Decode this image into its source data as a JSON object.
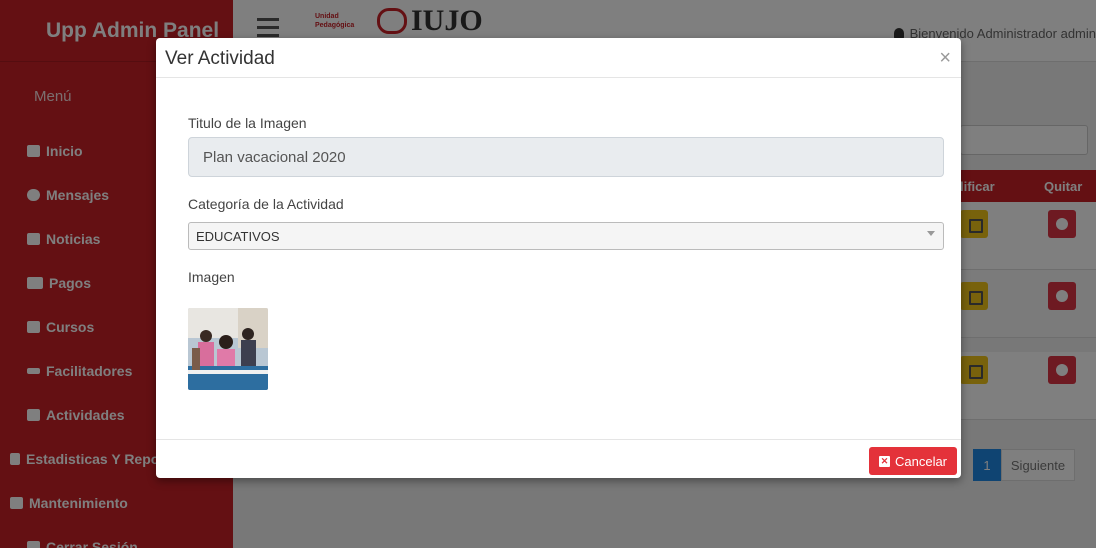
{
  "sidebar": {
    "brand": "Upp Admin Panel",
    "menu_title": "Menú",
    "items": [
      {
        "label": "Inicio",
        "icon": "home-icon"
      },
      {
        "label": "Mensajes",
        "icon": "chat-icon"
      },
      {
        "label": "Noticias",
        "icon": "newspaper-icon"
      },
      {
        "label": "Pagos",
        "icon": "credit-card-icon"
      },
      {
        "label": "Cursos",
        "icon": "book-icon"
      },
      {
        "label": "Facilitadores",
        "icon": "user-tie-icon"
      },
      {
        "label": "Actividades",
        "icon": "image-icon"
      },
      {
        "label": "Estadisticas Y Reportes",
        "icon": "pdf-file-icon"
      },
      {
        "label": "Mantenimiento",
        "icon": "tools-icon"
      },
      {
        "label": "Cerrar Sesión",
        "icon": "close-box-icon"
      }
    ]
  },
  "topbar": {
    "logo_small": "Unidad Pedagógica",
    "logo_text": "IUJO",
    "welcome": "Bienvenido Administrador admin"
  },
  "background": {
    "table_headers": [
      "lificar",
      "Quitar"
    ],
    "pagination": {
      "page": "1",
      "next": "Siguiente"
    }
  },
  "modal": {
    "title": "Ver Actividad",
    "close": "×",
    "title_label": "Titulo de la Imagen",
    "title_value": "Plan vacacional 2020",
    "category_label": "Categoría de la Actividad",
    "category_value": "EDUCATIVOS",
    "image_label": "Imagen",
    "cancel_button": "Cancelar"
  },
  "colors": {
    "brand_red": "#c82027",
    "cancel_red": "#e4323a",
    "edit_yellow": "#f0c419",
    "page_blue": "#1e88e5"
  }
}
